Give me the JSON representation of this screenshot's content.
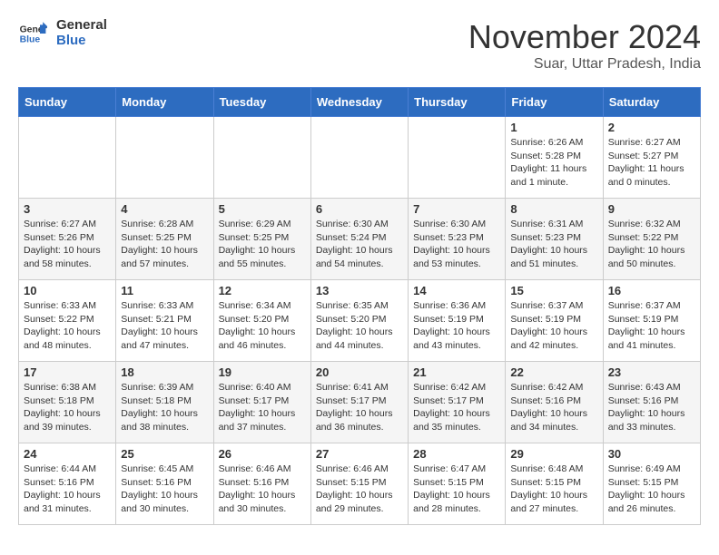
{
  "header": {
    "logo_line1": "General",
    "logo_line2": "Blue",
    "month": "November 2024",
    "location": "Suar, Uttar Pradesh, India"
  },
  "weekdays": [
    "Sunday",
    "Monday",
    "Tuesday",
    "Wednesday",
    "Thursday",
    "Friday",
    "Saturday"
  ],
  "weeks": [
    [
      {
        "day": "",
        "sunrise": "",
        "sunset": "",
        "daylight": ""
      },
      {
        "day": "",
        "sunrise": "",
        "sunset": "",
        "daylight": ""
      },
      {
        "day": "",
        "sunrise": "",
        "sunset": "",
        "daylight": ""
      },
      {
        "day": "",
        "sunrise": "",
        "sunset": "",
        "daylight": ""
      },
      {
        "day": "",
        "sunrise": "",
        "sunset": "",
        "daylight": ""
      },
      {
        "day": "1",
        "sunrise": "Sunrise: 6:26 AM",
        "sunset": "Sunset: 5:28 PM",
        "daylight": "Daylight: 11 hours and 1 minute."
      },
      {
        "day": "2",
        "sunrise": "Sunrise: 6:27 AM",
        "sunset": "Sunset: 5:27 PM",
        "daylight": "Daylight: 11 hours and 0 minutes."
      }
    ],
    [
      {
        "day": "3",
        "sunrise": "Sunrise: 6:27 AM",
        "sunset": "Sunset: 5:26 PM",
        "daylight": "Daylight: 10 hours and 58 minutes."
      },
      {
        "day": "4",
        "sunrise": "Sunrise: 6:28 AM",
        "sunset": "Sunset: 5:25 PM",
        "daylight": "Daylight: 10 hours and 57 minutes."
      },
      {
        "day": "5",
        "sunrise": "Sunrise: 6:29 AM",
        "sunset": "Sunset: 5:25 PM",
        "daylight": "Daylight: 10 hours and 55 minutes."
      },
      {
        "day": "6",
        "sunrise": "Sunrise: 6:30 AM",
        "sunset": "Sunset: 5:24 PM",
        "daylight": "Daylight: 10 hours and 54 minutes."
      },
      {
        "day": "7",
        "sunrise": "Sunrise: 6:30 AM",
        "sunset": "Sunset: 5:23 PM",
        "daylight": "Daylight: 10 hours and 53 minutes."
      },
      {
        "day": "8",
        "sunrise": "Sunrise: 6:31 AM",
        "sunset": "Sunset: 5:23 PM",
        "daylight": "Daylight: 10 hours and 51 minutes."
      },
      {
        "day": "9",
        "sunrise": "Sunrise: 6:32 AM",
        "sunset": "Sunset: 5:22 PM",
        "daylight": "Daylight: 10 hours and 50 minutes."
      }
    ],
    [
      {
        "day": "10",
        "sunrise": "Sunrise: 6:33 AM",
        "sunset": "Sunset: 5:22 PM",
        "daylight": "Daylight: 10 hours and 48 minutes."
      },
      {
        "day": "11",
        "sunrise": "Sunrise: 6:33 AM",
        "sunset": "Sunset: 5:21 PM",
        "daylight": "Daylight: 10 hours and 47 minutes."
      },
      {
        "day": "12",
        "sunrise": "Sunrise: 6:34 AM",
        "sunset": "Sunset: 5:20 PM",
        "daylight": "Daylight: 10 hours and 46 minutes."
      },
      {
        "day": "13",
        "sunrise": "Sunrise: 6:35 AM",
        "sunset": "Sunset: 5:20 PM",
        "daylight": "Daylight: 10 hours and 44 minutes."
      },
      {
        "day": "14",
        "sunrise": "Sunrise: 6:36 AM",
        "sunset": "Sunset: 5:19 PM",
        "daylight": "Daylight: 10 hours and 43 minutes."
      },
      {
        "day": "15",
        "sunrise": "Sunrise: 6:37 AM",
        "sunset": "Sunset: 5:19 PM",
        "daylight": "Daylight: 10 hours and 42 minutes."
      },
      {
        "day": "16",
        "sunrise": "Sunrise: 6:37 AM",
        "sunset": "Sunset: 5:19 PM",
        "daylight": "Daylight: 10 hours and 41 minutes."
      }
    ],
    [
      {
        "day": "17",
        "sunrise": "Sunrise: 6:38 AM",
        "sunset": "Sunset: 5:18 PM",
        "daylight": "Daylight: 10 hours and 39 minutes."
      },
      {
        "day": "18",
        "sunrise": "Sunrise: 6:39 AM",
        "sunset": "Sunset: 5:18 PM",
        "daylight": "Daylight: 10 hours and 38 minutes."
      },
      {
        "day": "19",
        "sunrise": "Sunrise: 6:40 AM",
        "sunset": "Sunset: 5:17 PM",
        "daylight": "Daylight: 10 hours and 37 minutes."
      },
      {
        "day": "20",
        "sunrise": "Sunrise: 6:41 AM",
        "sunset": "Sunset: 5:17 PM",
        "daylight": "Daylight: 10 hours and 36 minutes."
      },
      {
        "day": "21",
        "sunrise": "Sunrise: 6:42 AM",
        "sunset": "Sunset: 5:17 PM",
        "daylight": "Daylight: 10 hours and 35 minutes."
      },
      {
        "day": "22",
        "sunrise": "Sunrise: 6:42 AM",
        "sunset": "Sunset: 5:16 PM",
        "daylight": "Daylight: 10 hours and 34 minutes."
      },
      {
        "day": "23",
        "sunrise": "Sunrise: 6:43 AM",
        "sunset": "Sunset: 5:16 PM",
        "daylight": "Daylight: 10 hours and 33 minutes."
      }
    ],
    [
      {
        "day": "24",
        "sunrise": "Sunrise: 6:44 AM",
        "sunset": "Sunset: 5:16 PM",
        "daylight": "Daylight: 10 hours and 31 minutes."
      },
      {
        "day": "25",
        "sunrise": "Sunrise: 6:45 AM",
        "sunset": "Sunset: 5:16 PM",
        "daylight": "Daylight: 10 hours and 30 minutes."
      },
      {
        "day": "26",
        "sunrise": "Sunrise: 6:46 AM",
        "sunset": "Sunset: 5:16 PM",
        "daylight": "Daylight: 10 hours and 30 minutes."
      },
      {
        "day": "27",
        "sunrise": "Sunrise: 6:46 AM",
        "sunset": "Sunset: 5:15 PM",
        "daylight": "Daylight: 10 hours and 29 minutes."
      },
      {
        "day": "28",
        "sunrise": "Sunrise: 6:47 AM",
        "sunset": "Sunset: 5:15 PM",
        "daylight": "Daylight: 10 hours and 28 minutes."
      },
      {
        "day": "29",
        "sunrise": "Sunrise: 6:48 AM",
        "sunset": "Sunset: 5:15 PM",
        "daylight": "Daylight: 10 hours and 27 minutes."
      },
      {
        "day": "30",
        "sunrise": "Sunrise: 6:49 AM",
        "sunset": "Sunset: 5:15 PM",
        "daylight": "Daylight: 10 hours and 26 minutes."
      }
    ]
  ]
}
